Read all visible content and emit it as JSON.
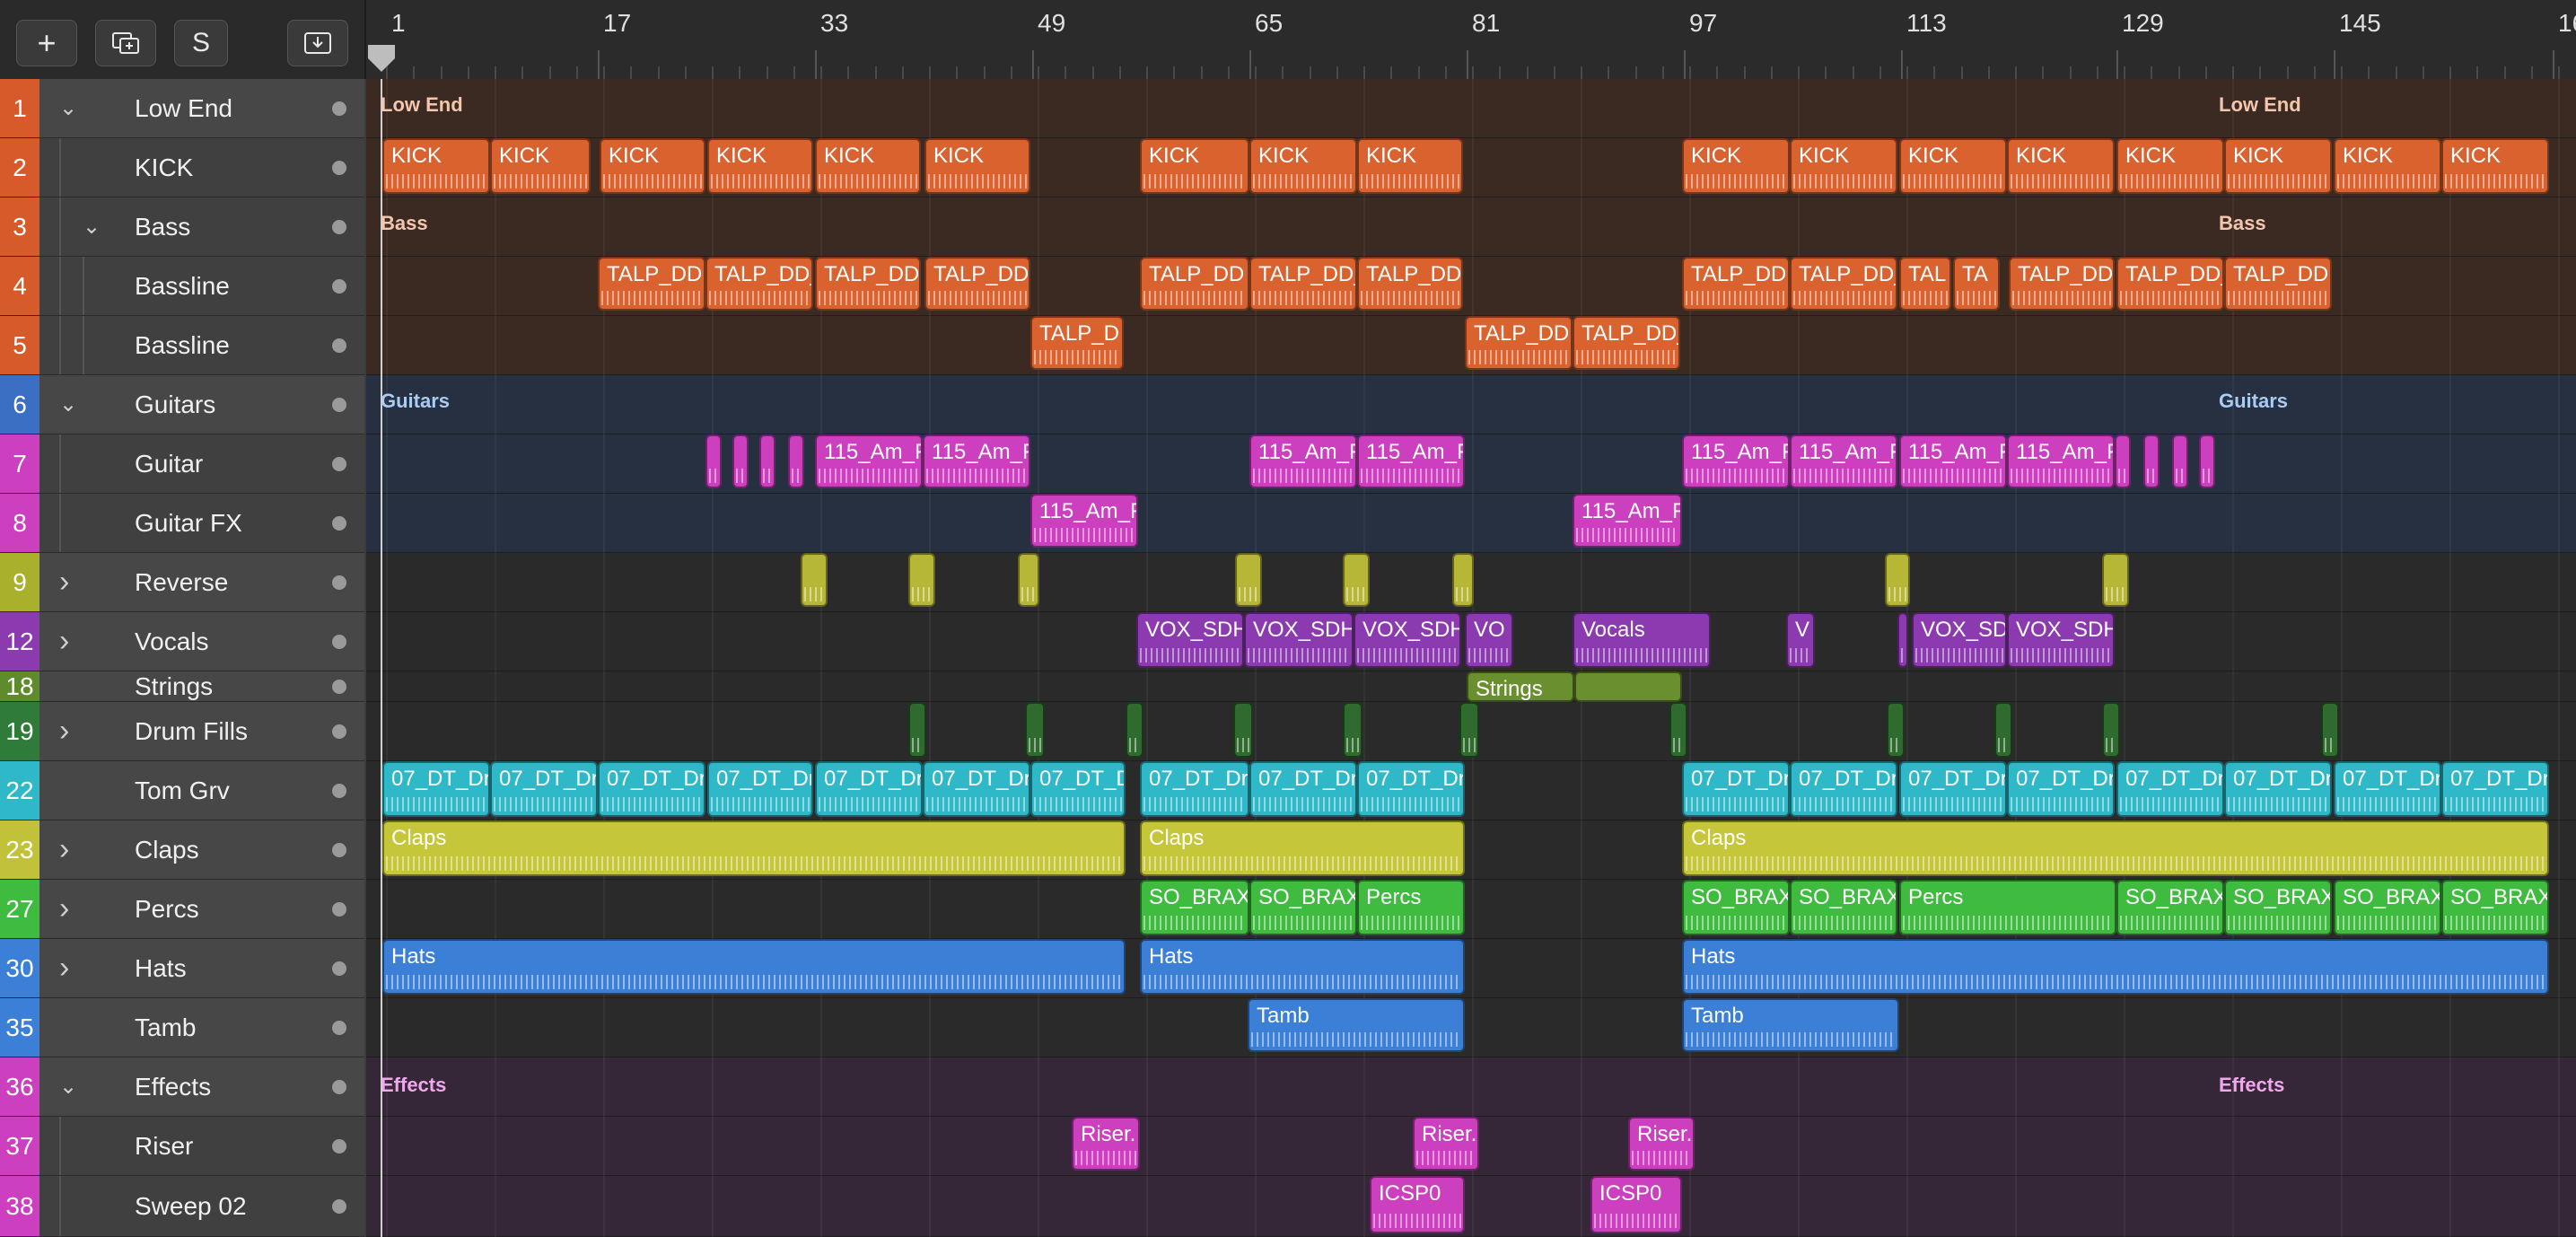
{
  "toolbar": {
    "add_label": "+",
    "duplicate_icon": "duplicate-track-icon",
    "solo_label": "S",
    "download_icon": "download-icon"
  },
  "ruler": {
    "bars": [
      "1",
      "17",
      "33",
      "49",
      "65",
      "81",
      "97",
      "113",
      "129",
      "145",
      "16"
    ]
  },
  "tracks": [
    {
      "num": "1",
      "name": "Low End",
      "color": "#d65a2a",
      "chevron": "down",
      "indent": 0
    },
    {
      "num": "2",
      "name": "KICK",
      "color": "#d65a2a",
      "chevron": "",
      "indent": 1
    },
    {
      "num": "3",
      "name": "Bass",
      "color": "#d65a2a",
      "chevron": "down",
      "indent": 1
    },
    {
      "num": "4",
      "name": "Bassline",
      "color": "#d65a2a",
      "chevron": "",
      "indent": 2
    },
    {
      "num": "5",
      "name": "Bassline",
      "color": "#d65a2a",
      "chevron": "",
      "indent": 2
    },
    {
      "num": "6",
      "name": "Guitars",
      "color": "#3b6fc4",
      "chevron": "down",
      "indent": 0
    },
    {
      "num": "7",
      "name": "Guitar",
      "color": "#cc3fbf",
      "chevron": "",
      "indent": 1
    },
    {
      "num": "8",
      "name": "Guitar FX",
      "color": "#cc3fbf",
      "chevron": "",
      "indent": 1
    },
    {
      "num": "9",
      "name": "Reverse",
      "color": "#a8b02c",
      "chevron": "right",
      "indent": 0
    },
    {
      "num": "12",
      "name": "Vocals",
      "color": "#8b3aaf",
      "chevron": "right",
      "indent": 0
    },
    {
      "num": "18",
      "name": "Strings",
      "color": "#5e8c2c",
      "chevron": "",
      "indent": 0
    },
    {
      "num": "19",
      "name": "Drum Fills",
      "color": "#2f7b3a",
      "chevron": "right",
      "indent": 0
    },
    {
      "num": "22",
      "name": "Tom Grv",
      "color": "#2fb8c7",
      "chevron": "",
      "indent": 0
    },
    {
      "num": "23",
      "name": "Claps",
      "color": "#c2c23a",
      "chevron": "right",
      "indent": 0
    },
    {
      "num": "27",
      "name": "Percs",
      "color": "#3fbb3f",
      "chevron": "right",
      "indent": 0
    },
    {
      "num": "30",
      "name": "Hats",
      "color": "#3b7fd6",
      "chevron": "right",
      "indent": 0
    },
    {
      "num": "35",
      "name": "Tamb",
      "color": "#3b7fd6",
      "chevron": "",
      "indent": 0
    },
    {
      "num": "36",
      "name": "Effects",
      "color": "#cc3fbf",
      "chevron": "down",
      "indent": 0
    },
    {
      "num": "37",
      "name": "Riser",
      "color": "#cc3fbf",
      "chevron": "",
      "indent": 1
    },
    {
      "num": "38",
      "name": "Sweep 02",
      "color": "#cc3fbf",
      "chevron": "",
      "indent": 1
    }
  ],
  "folders": {
    "low_end": "Low End",
    "bass": "Bass",
    "guitars": "Guitars",
    "effects": "Effects"
  },
  "regions": {
    "kick": "KICK",
    "talp": "TALP_DD",
    "talp2": "TALP_DD_",
    "talp3": "TALP_D",
    "tal": "TAL",
    "ta": "TA",
    "am": "115_Am_F",
    "vox": "VOX_SDH",
    "vo": "VO",
    "vox_short": "VOX_SD",
    "vocals": "Vocals",
    "v": "V",
    "strings": "Strings",
    "dt": "07_DT_Dr",
    "dt_short": "07_DT_D",
    "claps": "Claps",
    "brax": "SO_BRAX",
    "percs": "Percs",
    "hats": "Hats",
    "tamb": "Tamb",
    "riser": "Riser.",
    "icsp": "ICSP0"
  }
}
